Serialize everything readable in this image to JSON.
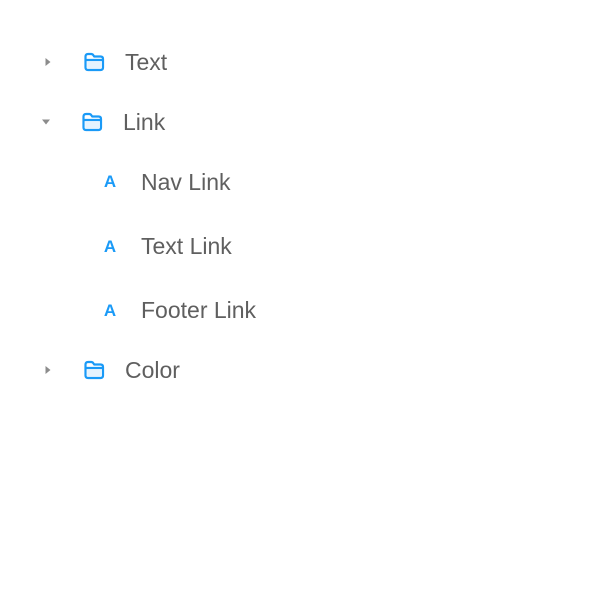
{
  "colors": {
    "accent": "#1a9af7",
    "caret": "#8c8c8c",
    "text": "#5f5f5f"
  },
  "tree": {
    "groups": [
      {
        "label": "Text",
        "expanded": false,
        "icon": "folder-icon",
        "caret_icon": "caret-right-icon"
      },
      {
        "label": "Link",
        "expanded": true,
        "icon": "folder-icon",
        "caret_icon": "caret-down-icon",
        "children": [
          {
            "label": "Nav Link",
            "type_glyph": "A",
            "icon": "text-style-icon"
          },
          {
            "label": "Text Link",
            "type_glyph": "A",
            "icon": "text-style-icon"
          },
          {
            "label": "Footer Link",
            "type_glyph": "A",
            "icon": "text-style-icon"
          }
        ]
      },
      {
        "label": "Color",
        "expanded": false,
        "icon": "folder-icon",
        "caret_icon": "caret-right-icon"
      }
    ]
  }
}
